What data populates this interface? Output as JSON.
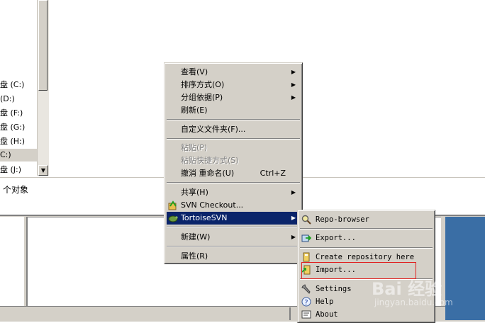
{
  "drives": [
    "盘 (C:)",
    "(D:)",
    "盘 (F:)",
    "盘 (G:)",
    "盘 (H:)",
    "C:)",
    "盘 (J:)"
  ],
  "status": {
    "objects_text": "个对象"
  },
  "context_menu": {
    "view": "查看(V)",
    "sort": "排序方式(O)",
    "group": "分组依据(P)",
    "refresh": "刷新(E)",
    "customize": "自定义文件夹(F)...",
    "paste": "粘贴(P)",
    "paste_shortcut": "粘贴快捷方式(S)",
    "undo_rename": "撤消 重命名(U)",
    "undo_shortcut": "Ctrl+Z",
    "share": "共享(H)",
    "svn_checkout": "SVN Checkout...",
    "tortoisesvn": "TortoiseSVN",
    "new": "新建(W)",
    "properties": "属性(R)"
  },
  "tortoise_submenu": {
    "repo_browser": "Repo-browser",
    "export": "Export...",
    "create_repo": "Create repository here",
    "import": "Import...",
    "settings": "Settings",
    "help": "Help",
    "about": "About"
  },
  "icons": {
    "repo_browser": "magnifier-icon",
    "export": "export-icon",
    "create_repo": "create-repo-icon",
    "import": "import-icon",
    "settings": "wrench-icon",
    "help": "help-icon",
    "about": "about-icon",
    "svn_checkout": "checkout-icon",
    "tortoisesvn": "tortoise-icon"
  },
  "colors": {
    "menu_bg": "#d4d0c8",
    "highlight": "#0a246a",
    "annotation_box": "#e02020",
    "desktop": "#3a6ea5"
  },
  "watermark": {
    "brand": "Bai 经验",
    "url": "jingyan.baidu.com"
  }
}
